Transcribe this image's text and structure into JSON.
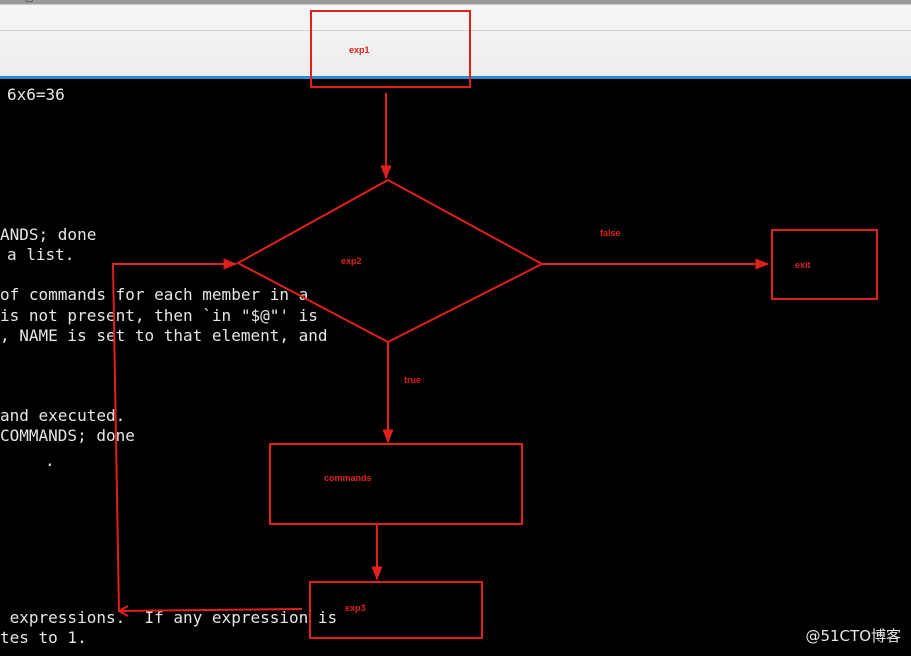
{
  "window": {
    "titlebar_glyphs": "— ◻ ✕"
  },
  "terminal": {
    "lines": [
      "6x6=36",
      "ANDS; done",
      "a list.",
      "of commands for each member in a",
      "is not present, then `in \"$@\"' is",
      ", NAME is set to that element, and",
      "and executed.",
      "COMMANDS; done",
      ".",
      " expressions.  If any expression is",
      "tes to 1."
    ]
  },
  "flowchart": {
    "nodes": {
      "exp1": "exp1",
      "exp2": "exp2",
      "exit": "exit",
      "commands": "commands",
      "exp3": "exp3"
    },
    "edges": {
      "false_label": "false",
      "true_label": "true"
    },
    "color": "#e0201c"
  },
  "watermark": "@51CTO博客"
}
